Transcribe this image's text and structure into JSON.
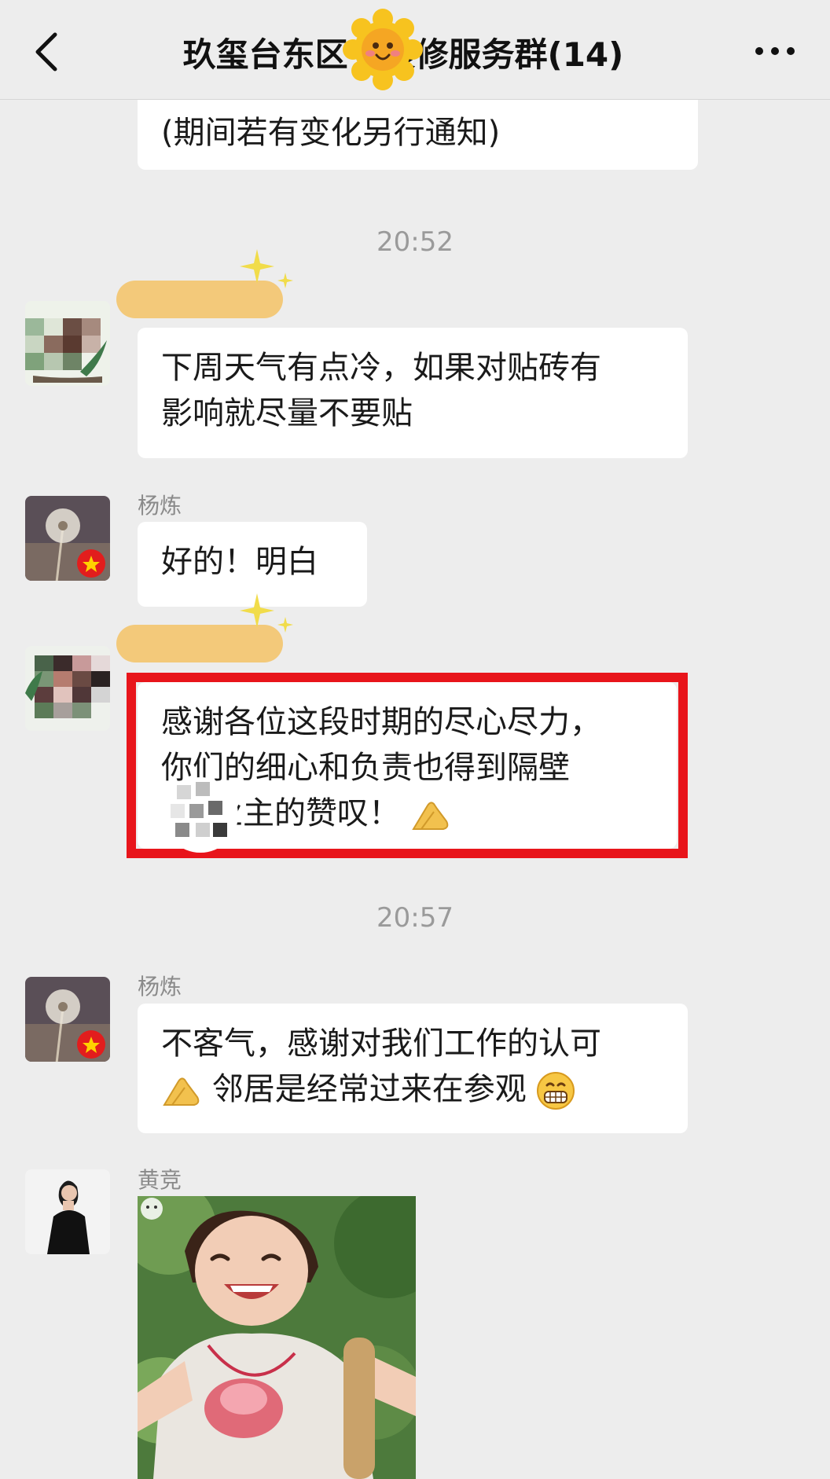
{
  "header": {
    "title": "玖玺台东区  1装修服务群(14)",
    "back_icon": "chevron-left-icon",
    "more_icon": "more-dots-icon"
  },
  "messages": {
    "m0_text": "(期间若有变化另行通知)",
    "time1": "20:52",
    "m1_lines": [
      "下周天气有点冷，如果对贴砖有",
      "影响就尽量不要贴"
    ],
    "m2_sender": "杨炼",
    "m2_text": "好的！明白",
    "m3_lines": [
      "感谢各位这段时期的尽心尽力，",
      "你们的细心和负责也得到隔壁",
      "业主的赞叹！"
    ],
    "time2": "20:57",
    "m4_sender": "杨炼",
    "m4_lines": [
      "不客气，感谢对我们工作的认可",
      "邻居是经常过来在参观"
    ],
    "m5_sender": "黄竞"
  },
  "colors": {
    "background": "#ededed",
    "bubble": "#ffffff",
    "highlight": "#e8151b",
    "timestamp": "#9a9a9a"
  }
}
